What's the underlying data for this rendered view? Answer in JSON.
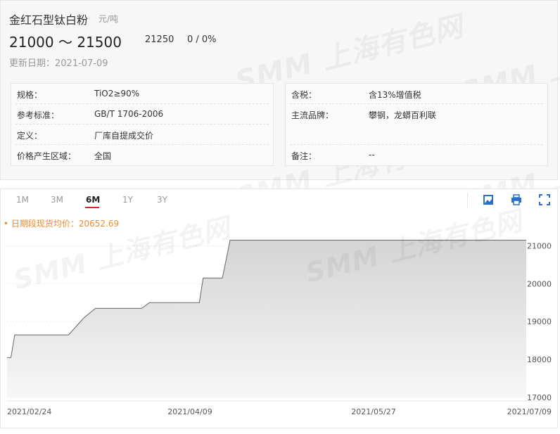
{
  "header": {
    "product_title": "金红石型钛白粉",
    "unit": "元/吨",
    "price_range": "21000 ～ 21500",
    "price_mid": "21250",
    "price_change": "0 / 0%",
    "update_date": "更新日期：2021-07-09"
  },
  "watermark": "SMM 上海有色网",
  "specs_left": [
    {
      "label": "规格：",
      "value": "TiO2≥90%"
    },
    {
      "label": "参考标准：",
      "value": "GB/T 1706-2006"
    },
    {
      "label": "定义：",
      "value": "厂库自提成交价"
    },
    {
      "label": "价格产生区域：",
      "value": "全国"
    }
  ],
  "specs_right": [
    {
      "label": "含税：",
      "value": "含13%增值税"
    },
    {
      "label": "主流品牌：",
      "value": "攀钢，龙蟒百利联"
    },
    {
      "label": "备注：",
      "value": "--"
    }
  ],
  "tabs": [
    "1M",
    "3M",
    "6M",
    "1Y",
    "3Y"
  ],
  "active_tab": "6M",
  "tools": [
    "image-download-icon",
    "print-icon",
    "fullscreen-icon"
  ],
  "avg_label": "• 日期段现货均价：20652.69",
  "colors": {
    "avg": "#f08a2c",
    "tab_accent": "#dd2222",
    "line": "#666666",
    "fill_top": "#d4d4d4",
    "fill_bottom": "#f7f7f7"
  },
  "chart_data": {
    "type": "area",
    "step": true,
    "x_tick_labels": [
      "2021/02/24",
      "2021/04/09",
      "2021/05/27",
      "2021/07/09"
    ],
    "y_ticks": [
      17000,
      18000,
      19000,
      20000,
      21000
    ],
    "ylim": [
      17000,
      21250
    ],
    "grid": true,
    "series": [
      {
        "points": [
          {
            "x": "2021-02-24",
            "y": 18050
          },
          {
            "x": "2021-02-25",
            "y": 18050
          },
          {
            "x": "2021-02-26",
            "y": 18650
          },
          {
            "x": "2021-03-12",
            "y": 18650
          },
          {
            "x": "2021-03-16",
            "y": 19100
          },
          {
            "x": "2021-03-19",
            "y": 19350
          },
          {
            "x": "2021-03-31",
            "y": 19350
          },
          {
            "x": "2021-04-02",
            "y": 19500
          },
          {
            "x": "2021-04-15",
            "y": 19500
          },
          {
            "x": "2021-04-16",
            "y": 20150
          },
          {
            "x": "2021-04-21",
            "y": 20150
          },
          {
            "x": "2021-04-23",
            "y": 21150
          },
          {
            "x": "2021-07-09",
            "y": 21150
          }
        ]
      }
    ]
  }
}
